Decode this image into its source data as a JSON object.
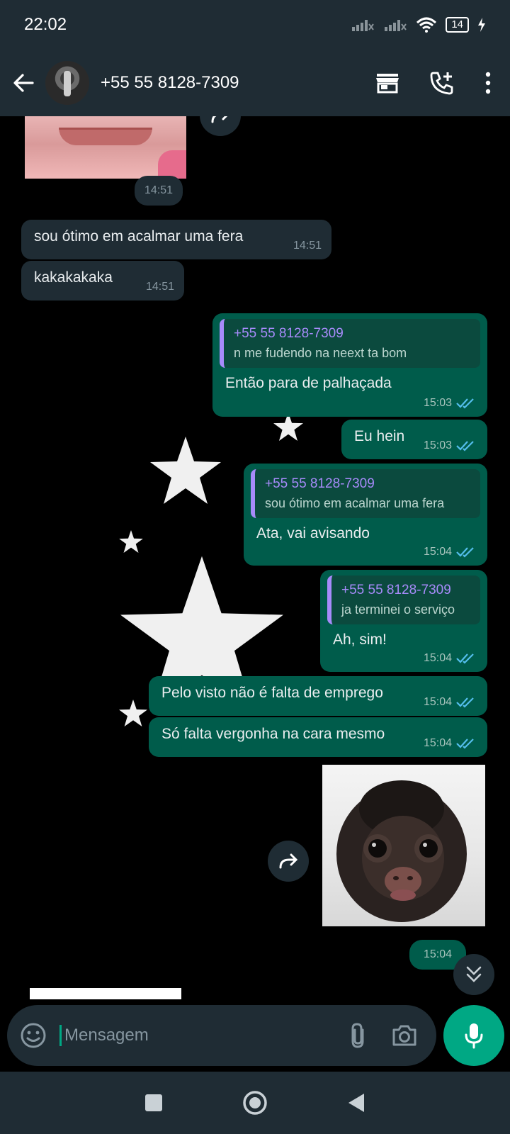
{
  "status_bar": {
    "time": "22:02",
    "battery": "14"
  },
  "header": {
    "contact_name": "+55 55 8128-7309"
  },
  "messages": [
    {
      "id": "m0",
      "type": "image",
      "direction": "incoming",
      "time": "14:51"
    },
    {
      "id": "m1",
      "direction": "incoming",
      "text": "sou ótimo em acalmar uma fera",
      "time": "14:51"
    },
    {
      "id": "m2",
      "direction": "incoming",
      "text": "kakakakaka",
      "time": "14:51"
    },
    {
      "id": "m3",
      "direction": "outgoing",
      "quote_name": "+55 55 8128-7309",
      "quote_text": "n me fudendo na neext ta bom",
      "text": "Então para de palhaçada",
      "time": "15:03"
    },
    {
      "id": "m4",
      "direction": "outgoing",
      "text": "Eu hein",
      "time": "15:03"
    },
    {
      "id": "m5",
      "direction": "outgoing",
      "quote_name": "+55 55 8128-7309",
      "quote_text": "sou ótimo em acalmar uma fera",
      "text": "Ata, vai avisando",
      "time": "15:04"
    },
    {
      "id": "m6",
      "direction": "outgoing",
      "quote_name": "+55 55 8128-7309",
      "quote_text": "ja terminei o serviço",
      "text": "Ah, sim!",
      "time": "15:04"
    },
    {
      "id": "m7",
      "direction": "outgoing",
      "text": "Pelo visto não é falta de emprego",
      "time": "15:04"
    },
    {
      "id": "m8",
      "direction": "outgoing",
      "text": "Só falta vergonha na cara mesmo",
      "time": "15:04"
    },
    {
      "id": "m9",
      "type": "image",
      "direction": "outgoing",
      "time": "15:04"
    }
  ],
  "composer": {
    "placeholder": "Mensagem"
  },
  "icons": {
    "back": "arrow-left-icon",
    "shop": "store-icon",
    "call": "add-call-icon",
    "menu": "more-vertical-icon",
    "emoji": "emoji-icon",
    "attach": "paperclip-icon",
    "camera": "camera-icon",
    "mic": "microphone-icon",
    "forward": "forward-icon",
    "read": "double-check-icon",
    "scroll": "chevron-double-down-icon"
  },
  "colors": {
    "header": "#1f2c34",
    "incoming": "#1f2c34",
    "outgoing": "#005c4b",
    "accent": "#00a884",
    "quote_name": "#a78bfa",
    "read_tick": "#53bdeb"
  }
}
